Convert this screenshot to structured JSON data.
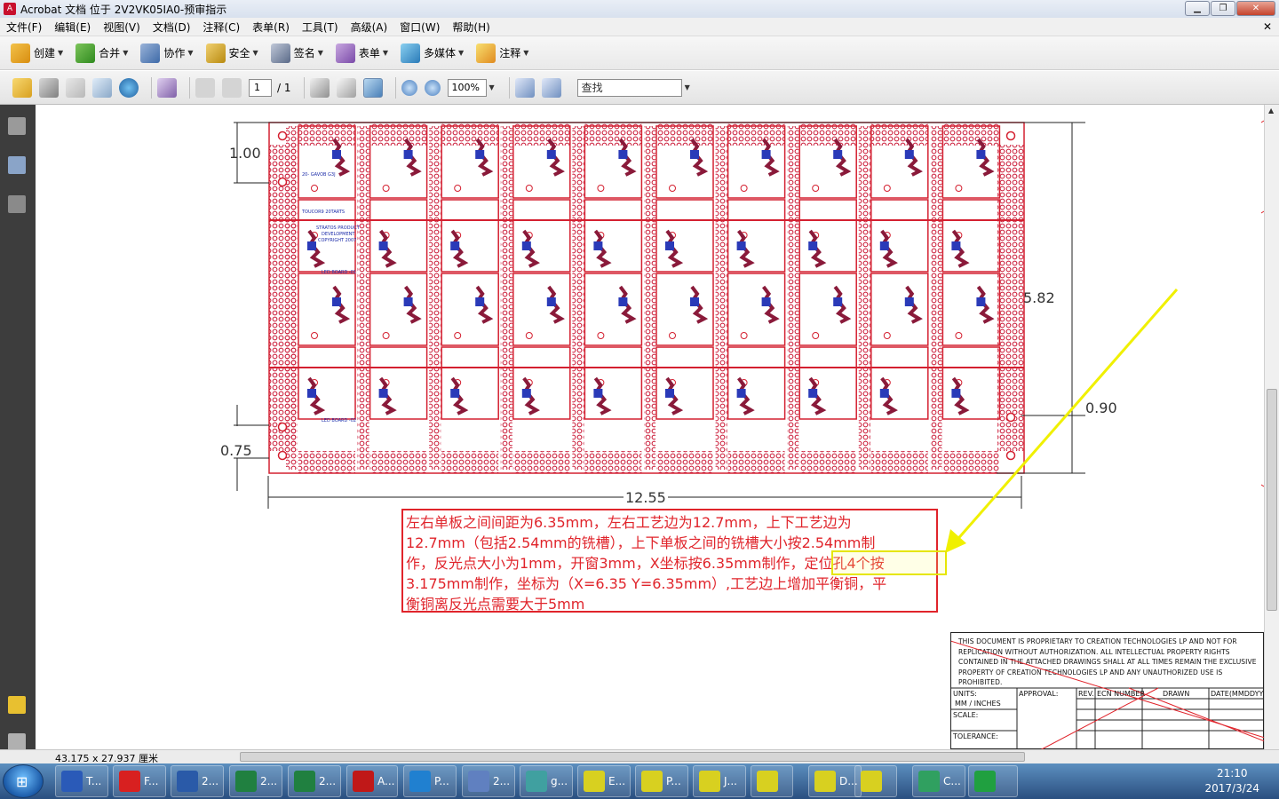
{
  "window": {
    "title": "Acrobat 文档 位于 2V2VK05IA0-预审指示",
    "app_icon": "pdf-icon"
  },
  "menu": [
    "文件(F)",
    "编辑(E)",
    "视图(V)",
    "文档(D)",
    "注释(C)",
    "表单(R)",
    "工具(T)",
    "高级(A)",
    "窗口(W)",
    "帮助(H)"
  ],
  "task_toolbar": [
    "创建",
    "合并",
    "协作",
    "安全",
    "签名",
    "表单",
    "多媒体",
    "注释"
  ],
  "std_toolbar": {
    "page_current": "1",
    "page_total": "/ 1",
    "zoom": "100%",
    "search_placeholder": "查找"
  },
  "drawing": {
    "dims": [
      "1.00",
      "5.82",
      "0.90",
      "0.75",
      "12.55"
    ],
    "board_labels": {
      "copy1": "STRATOS PRODUCT",
      "copy2": "DEVELOPMENT",
      "copy3": "COPYRIGHT 2007",
      "board_a": "LED BOARD -01",
      "board_b": "LED BOARD -02",
      "mirror_a": "20- GAVOB G3J",
      "mirror_b": "TOUCOR9 20TARTS"
    }
  },
  "annotation": {
    "line1": "左右单板之间间距为6.35mm，左右工艺边为12.7mm，上下工艺边为",
    "line2": "12.7mm（包括2.54mm的铣槽），上下单板之间的铣槽大小按2.54mm制",
    "line3": "作，反光点大小为1mm，开窗3mm，X坐标按6.35mm制作，定位孔4个按",
    "line4": "3.175mm制作，坐标为（X=6.35 Y=6.35mm）,工艺边上增加平衡铜，平",
    "line5": "衡铜离反光点需要大于5mm"
  },
  "title_block": {
    "notice": "THIS DOCUMENT IS PROPRIETARY TO CREATION TECHNOLOGIES LP AND NOT FOR REPLICATION WITHOUT AUTHORIZATION. ALL INTELLECTUAL PROPERTY RIGHTS CONTAINED IN THE ATTACHED DRAWINGS SHALL AT ALL TIMES REMAIN THE EXCLUSIVE PROPERTY OF CREATION TECHNOLOGIES LP AND ANY UNAUTHORIZED USE IS PROHIBITED.",
    "units_label": "UNITS:",
    "units_value": "MM / INCHES",
    "scale_label": "SCALE:",
    "tolerance_label": "TOLERANCE:",
    "approval_label": "APPROVAL:",
    "rev_label": "REV.",
    "ecn_label": "ECN NUMBER",
    "drawn_label": "DRAWN",
    "date_label": "DATE(MMDDYY)"
  },
  "status": {
    "page_size": "43.175 x 27.937 厘米"
  },
  "os_taskbar": {
    "items": [
      {
        "label": "T...",
        "icon": "floppy-icon"
      },
      {
        "label": "F...",
        "icon": "foxit-icon"
      },
      {
        "label": "2...",
        "icon": "word-icon"
      },
      {
        "label": "2...",
        "icon": "excel-icon"
      },
      {
        "label": "2...",
        "icon": "excel-icon"
      },
      {
        "label": "A...",
        "icon": "acrobat-icon"
      },
      {
        "label": "P...",
        "icon": "app-f-icon"
      },
      {
        "label": "2...",
        "icon": "text-icon"
      },
      {
        "label": "g...",
        "icon": "eye-icon"
      },
      {
        "label": "E...",
        "icon": "x-window-icon"
      },
      {
        "label": "P...",
        "icon": "x-window-icon"
      },
      {
        "label": "J...",
        "icon": "x-window-icon"
      },
      {
        "label": "",
        "icon": "x-window-icon"
      },
      {
        "label": "D...",
        "icon": "x-window-icon"
      },
      {
        "label": "",
        "icon": "x-window-icon"
      },
      {
        "label": "C...",
        "icon": "chameleon-icon"
      },
      {
        "label": "",
        "icon": "p-app-icon"
      }
    ],
    "time": "21:10",
    "date": "2017/3/24"
  },
  "colors": {
    "pcb_red": "#d42030",
    "anno_red": "#e0242b",
    "arrow_yellow": "#f0f000",
    "nav_dark": "#3d3d3d"
  }
}
